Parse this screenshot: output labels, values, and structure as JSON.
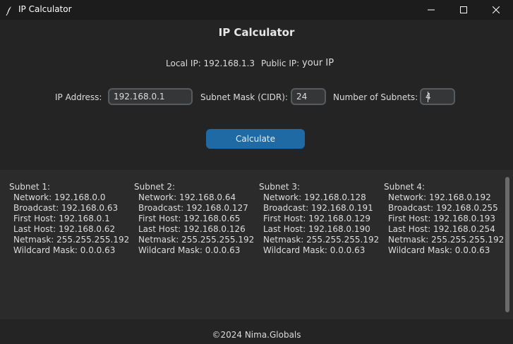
{
  "window": {
    "title": "IP Calculator",
    "icon": "feather-icon",
    "controls": [
      "minimize-icon",
      "maximize-icon",
      "close-icon"
    ]
  },
  "header": {
    "title": "IP Calculator"
  },
  "info": {
    "local_ip": "Local IP: 192.168.1.3",
    "public_ip_label": "Public IP:",
    "public_ip_value": "your IP"
  },
  "form": {
    "ip_label": "IP Address:",
    "ip_value": "192.168.0.1",
    "mask_label": "Subnet Mask (CIDR):",
    "mask_value": "24",
    "subnets_label": "Number of Subnets:",
    "subnets_value": "4",
    "calculate_label": "Calculate"
  },
  "results": [
    {
      "title": "Subnet 1:",
      "network": "Network: 192.168.0.0",
      "broadcast": "Broadcast: 192.168.0.63",
      "first_host": "First Host: 192.168.0.1",
      "last_host": "Last Host: 192.168.0.62",
      "netmask": "Netmask: 255.255.255.192",
      "wildcard": "Wildcard Mask: 0.0.0.63"
    },
    {
      "title": "Subnet 2:",
      "network": "Network: 192.168.0.64",
      "broadcast": "Broadcast: 192.168.0.127",
      "first_host": "First Host: 192.168.0.65",
      "last_host": "Last Host: 192.168.0.126",
      "netmask": "Netmask: 255.255.255.192",
      "wildcard": "Wildcard Mask: 0.0.0.63"
    },
    {
      "title": "Subnet 3:",
      "network": "Network: 192.168.0.128",
      "broadcast": "Broadcast: 192.168.0.191",
      "first_host": "First Host: 192.168.0.129",
      "last_host": "Last Host: 192.168.0.190",
      "netmask": "Netmask: 255.255.255.192",
      "wildcard": "Wildcard Mask: 0.0.0.63"
    },
    {
      "title": "Subnet 4:",
      "network": "Network: 192.168.0.192",
      "broadcast": "Broadcast: 192.168.0.255",
      "first_host": "First Host: 192.168.0.193",
      "last_host": "Last Host: 192.168.0.254",
      "netmask": "Netmask: 255.255.255.192",
      "wildcard": "Wildcard Mask: 0.0.0.63"
    }
  ],
  "footer": {
    "text": "©2024 Nima.Globals"
  },
  "colors": {
    "background": "#242424",
    "titlebar": "#1c1c1c",
    "panel": "#2b2b2b",
    "accent": "#1f6aa5",
    "input_bg": "#343638",
    "input_border": "#565b5e"
  }
}
